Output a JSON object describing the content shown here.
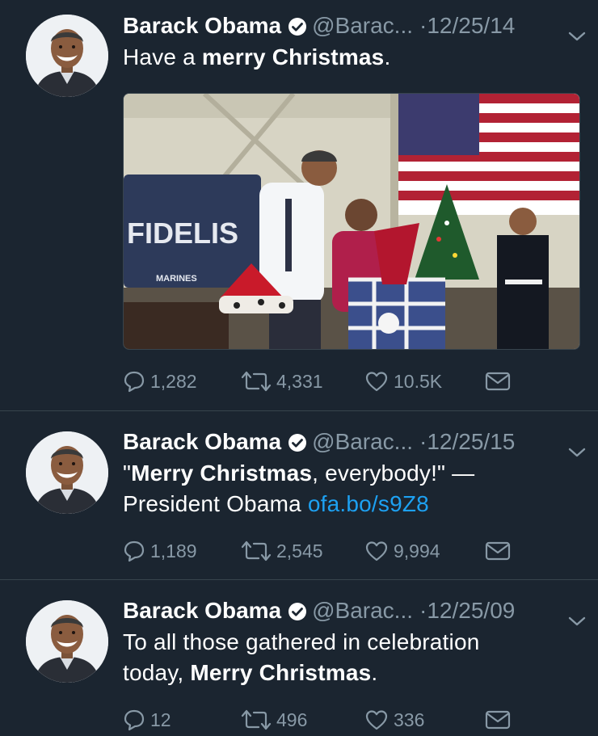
{
  "colors": {
    "background": "#1b2530",
    "text": "#ffffff",
    "muted": "#8899a6",
    "link": "#1da1f2",
    "divider": "#38444d"
  },
  "tweets": [
    {
      "name": "Barack Obama",
      "handle": "@Barac...",
      "dot": "·",
      "date": "12/25/14",
      "text_plain_1": "Have a ",
      "text_bold_1": "merry Christmas",
      "text_plain_2": ".",
      "media": {
        "sign_text": "FIDELIS",
        "banner_text": "MARINES",
        "icon": "photo-christmas-event"
      },
      "replies": "1,282",
      "retweets": "4,331",
      "likes": "10.5K"
    },
    {
      "name": "Barack Obama",
      "handle": "@Barac...",
      "dot": "·",
      "date": "12/25/15",
      "text_plain_1": "\"",
      "text_bold_1": "Merry Christmas",
      "text_plain_2": ", everybody!\" —",
      "text_line_2": "President Obama ",
      "link": "ofa.bo/s9Z8",
      "replies": "1,189",
      "retweets": "2,545",
      "likes": "9,994"
    },
    {
      "name": "Barack Obama",
      "handle": "@Barac...",
      "dot": "·",
      "date": "12/25/09",
      "text_line_1": "To all those gathered in celebration",
      "text_plain_1": "today, ",
      "text_bold_1": "Merry Christmas",
      "text_plain_2": ".",
      "replies": "12",
      "retweets": "496",
      "likes": "336"
    }
  ]
}
